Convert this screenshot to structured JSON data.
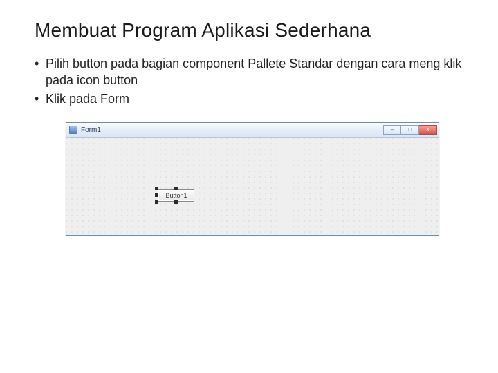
{
  "slide": {
    "title": "Membuat Program Aplikasi Sederhana",
    "bullets": [
      "Pilih button pada bagian component Pallete Standar dengan cara meng klik pada icon button",
      "Klik pada Form"
    ]
  },
  "form_window": {
    "title": "Form1",
    "placed_button_caption": "Button1",
    "window_buttons": {
      "minimize_glyph": "–",
      "maximize_glyph": "□",
      "close_glyph": "×"
    }
  }
}
